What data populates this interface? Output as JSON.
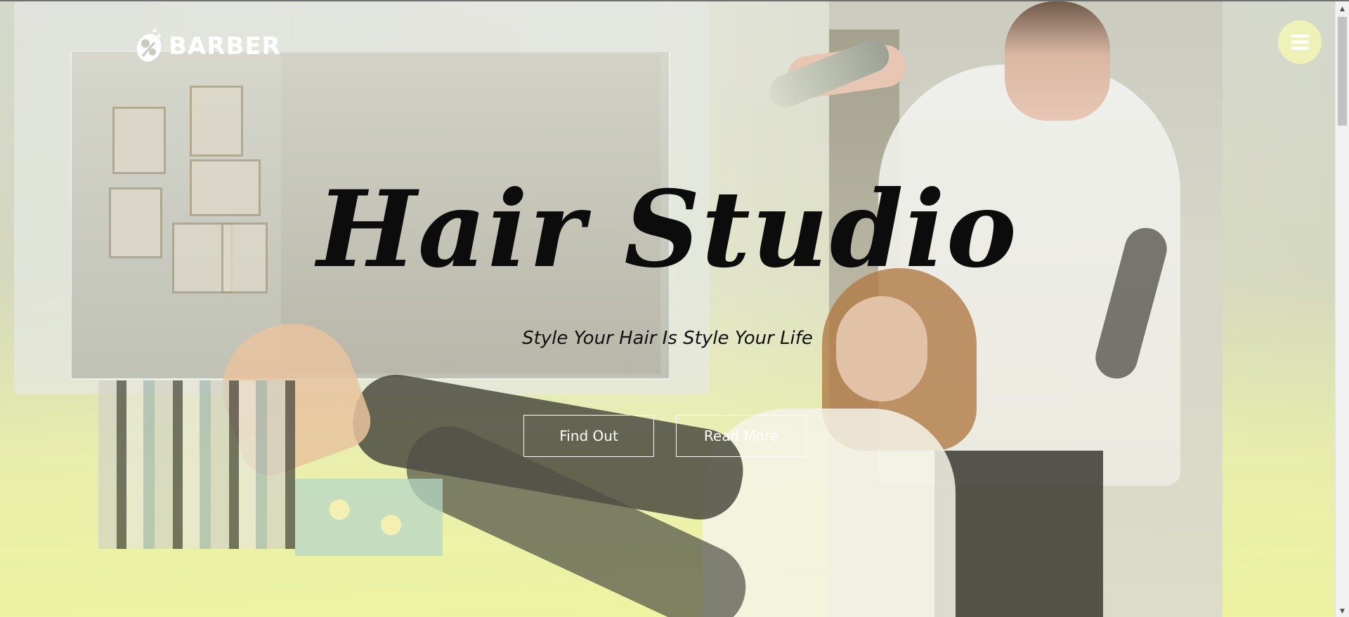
{
  "header": {
    "logo_text": "BARBER",
    "logo_icon": "scissors-comb-icon",
    "menu_icon": "hamburger-menu-icon"
  },
  "hero": {
    "title": "Hair Studio",
    "subtitle": "Style Your Hair Is Style Your Life",
    "buttons": [
      {
        "label": "Find Out"
      },
      {
        "label": "Read More"
      }
    ]
  },
  "colors": {
    "accent": "#eef2b7",
    "overlay": "#eef4a0",
    "title_text": "#0c0c0c",
    "button_border": "#ffffff"
  },
  "scrollbar": {
    "up_icon": "scroll-up-arrow-icon",
    "down_icon": "scroll-down-arrow-icon"
  }
}
